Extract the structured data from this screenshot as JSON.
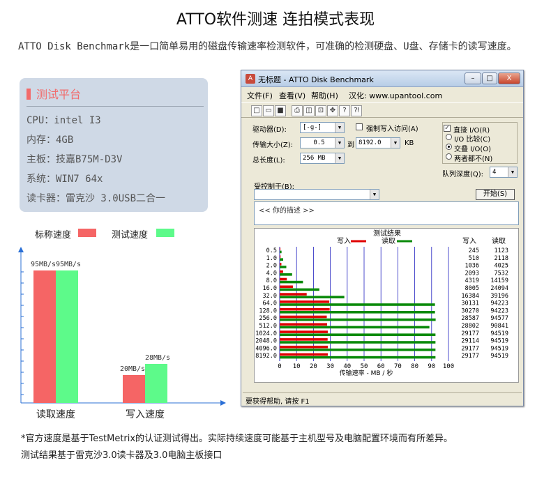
{
  "title": "ATTO软件测速 连拍模式表现",
  "intro": "ATTO Disk Benchmark是一口简单易用的磁盘传输速率检测软件，可准确的检测硬盘、U盘、存储卡的读写速度。",
  "spec": {
    "header": "测试平台",
    "rows": [
      "CPU：intel I3",
      "内存：4GB",
      "主板：技嘉B75M-D3V",
      "系统：WIN7 64x",
      "读卡器：雷克沙 3.0USB二合一"
    ]
  },
  "speed_chart": {
    "legend_rated": "标称速度",
    "legend_tested": "测试速度",
    "colors": {
      "rated": "#f56565",
      "tested": "#5dfa8a"
    }
  },
  "chart_data": [
    {
      "type": "bar",
      "categories": [
        "读取速度",
        "写入速度"
      ],
      "series": [
        {
          "name": "标称速度",
          "values": [
            95,
            20
          ]
        },
        {
          "name": "测试速度",
          "values": [
            95,
            28
          ]
        }
      ],
      "data_labels": [
        [
          "95MB/s",
          "20MB/s"
        ],
        [
          "95MB/s",
          "28MB/s"
        ]
      ],
      "legend": "top"
    },
    {
      "type": "bar",
      "orientation": "horizontal",
      "title": "测试结果",
      "xlabel": "传输速率 - MB / 秒",
      "xlim": [
        0,
        100
      ],
      "xticks": [
        0,
        10,
        20,
        30,
        40,
        50,
        60,
        70,
        80,
        90,
        100
      ],
      "categories": [
        "0.5",
        "1.0",
        "2.0",
        "4.0",
        "8.0",
        "16.0",
        "32.0",
        "64.0",
        "128.0",
        "256.0",
        "512.0",
        "1024.0",
        "2048.0",
        "4096.0",
        "8192.0"
      ],
      "series": [
        {
          "name": "写入",
          "values": [
            0.24,
            0.5,
            1.01,
            2.04,
            4.22,
            7.82,
            16.0,
            29.4,
            29.6,
            27.9,
            28.1,
            28.5,
            28.4,
            28.5,
            28.5
          ]
        },
        {
          "name": "读取",
          "values": [
            1.1,
            2.07,
            3.93,
            7.36,
            13.8,
            23.5,
            38.3,
            92.0,
            92.0,
            92.4,
            88.7,
            92.3,
            92.3,
            92.3,
            92.3
          ]
        }
      ],
      "table_headers": [
        "写入",
        "读取"
      ],
      "write_kb": [
        "245",
        "510",
        "1036",
        "2093",
        "4319",
        "8005",
        "16384",
        "30131",
        "30270",
        "28587",
        "28802",
        "29177",
        "29114",
        "29177",
        "29177"
      ],
      "read_kb": [
        "1123",
        "2118",
        "4025",
        "7532",
        "14159",
        "24094",
        "39196",
        "94223",
        "94223",
        "94577",
        "90841",
        "94519",
        "94519",
        "94519",
        "94519"
      ],
      "colors": {
        "write": "#e00000",
        "read": "#0a8a0a",
        "grid": "#2020c0"
      }
    }
  ],
  "window": {
    "title": "无标题 - ATTO Disk Benchmark",
    "buttons": {
      "minimize": "–",
      "maximize": "□",
      "close": "X"
    },
    "menus": [
      "文件(F)",
      "查看(V)",
      "帮助(H)"
    ],
    "sinicized": "汉化: www.upantool.com",
    "drive_label": "驱动器(D):",
    "drive_value": "[-g-]",
    "force_write_label": "强制写入访问(A)",
    "direct_io_label": "直接 I/O(R)",
    "transfer_size_label": "传输大小(Z):",
    "transfer_from": "0.5",
    "to_label": "到",
    "transfer_to": "8192.0",
    "kb_label": "KB",
    "total_length_label": "总长度(L):",
    "total_length_value": "256 MB",
    "io_compare": "I/O 比较(C)",
    "overlap_io": "交叠 I/O(O)",
    "neither": "两者都不(N)",
    "queue_depth_label": "队列深度(Q):",
    "queue_depth_value": "4",
    "controlled_by_label": "受控制于(B):",
    "start_button": "开始(S)",
    "desc_text": "<<  你的描述  >>",
    "result_title": "测试结果",
    "legend_write": "写入",
    "legend_read": "读取",
    "col_write": "写入",
    "col_read": "读取",
    "status": "要获得帮助, 请按 F1"
  },
  "footnotes": [
    "*官方速度是基于TestMetrix的认证测试得出。实际持续速度可能基于主机型号及电脑配置环境而有所差异。",
    "测试结果基于雷克沙3.0读卡器及3.0电脑主板接口"
  ]
}
